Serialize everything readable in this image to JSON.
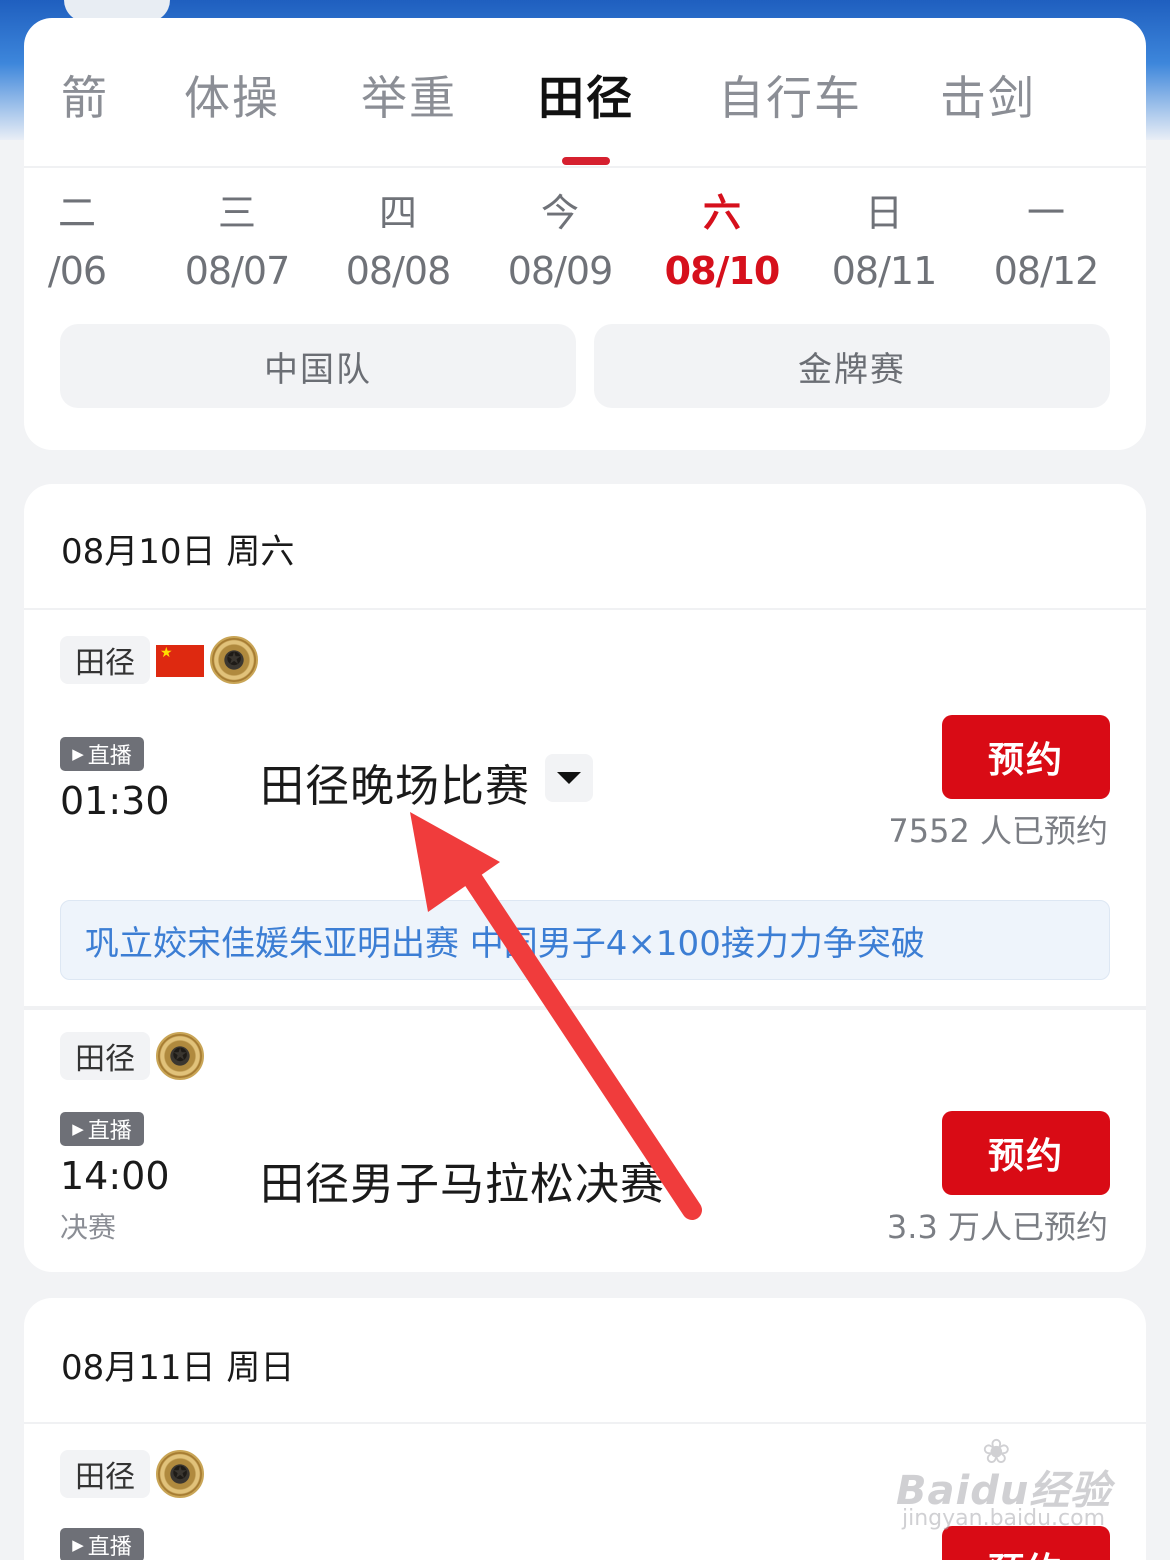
{
  "sport_tabs": [
    {
      "label": "箭",
      "active": false
    },
    {
      "label": "体操",
      "active": false
    },
    {
      "label": "举重",
      "active": false
    },
    {
      "label": "田径",
      "active": true
    },
    {
      "label": "自行车",
      "active": false
    },
    {
      "label": "击剑",
      "active": false
    }
  ],
  "dates": [
    {
      "weekday": "二",
      "date": "/06",
      "active": false
    },
    {
      "weekday": "三",
      "date": "08/07",
      "active": false
    },
    {
      "weekday": "四",
      "date": "08/08",
      "active": false
    },
    {
      "weekday": "今",
      "date": "08/09",
      "active": false
    },
    {
      "weekday": "六",
      "date": "08/10",
      "active": true
    },
    {
      "weekday": "日",
      "date": "08/11",
      "active": false
    },
    {
      "weekday": "一",
      "date": "08/12",
      "active": false
    }
  ],
  "filters": {
    "china_team": "中国队",
    "gold_medal": "金牌赛"
  },
  "day1": {
    "header": "08月10日 周六",
    "events": [
      {
        "sport": "田径",
        "live": "直播",
        "time": "01:30",
        "title": "田径晚场比赛",
        "reserve_label": "预约",
        "reserve_count": "7552 人已预约",
        "news": "巩立姣宋佳媛朱亚明出赛 中国男子4×100接力力争突破"
      },
      {
        "sport": "田径",
        "live": "直播",
        "time": "14:00",
        "stage": "决赛",
        "title": "田径男子马拉松决赛",
        "reserve_label": "预约",
        "reserve_count": "3.3 万人已预约"
      }
    ]
  },
  "day2": {
    "header": "08月11日 周日",
    "events": [
      {
        "sport": "田径",
        "live": "直播",
        "reserve_label": "预约"
      }
    ]
  },
  "watermark": {
    "main": "Baidu经验",
    "sub": "jingyan.baidu.com"
  },
  "colors": {
    "accent_red": "#d90b15",
    "active_date": "#d6101c",
    "news_blue": "#3c7ed4",
    "arrow": "#f03c3c"
  }
}
